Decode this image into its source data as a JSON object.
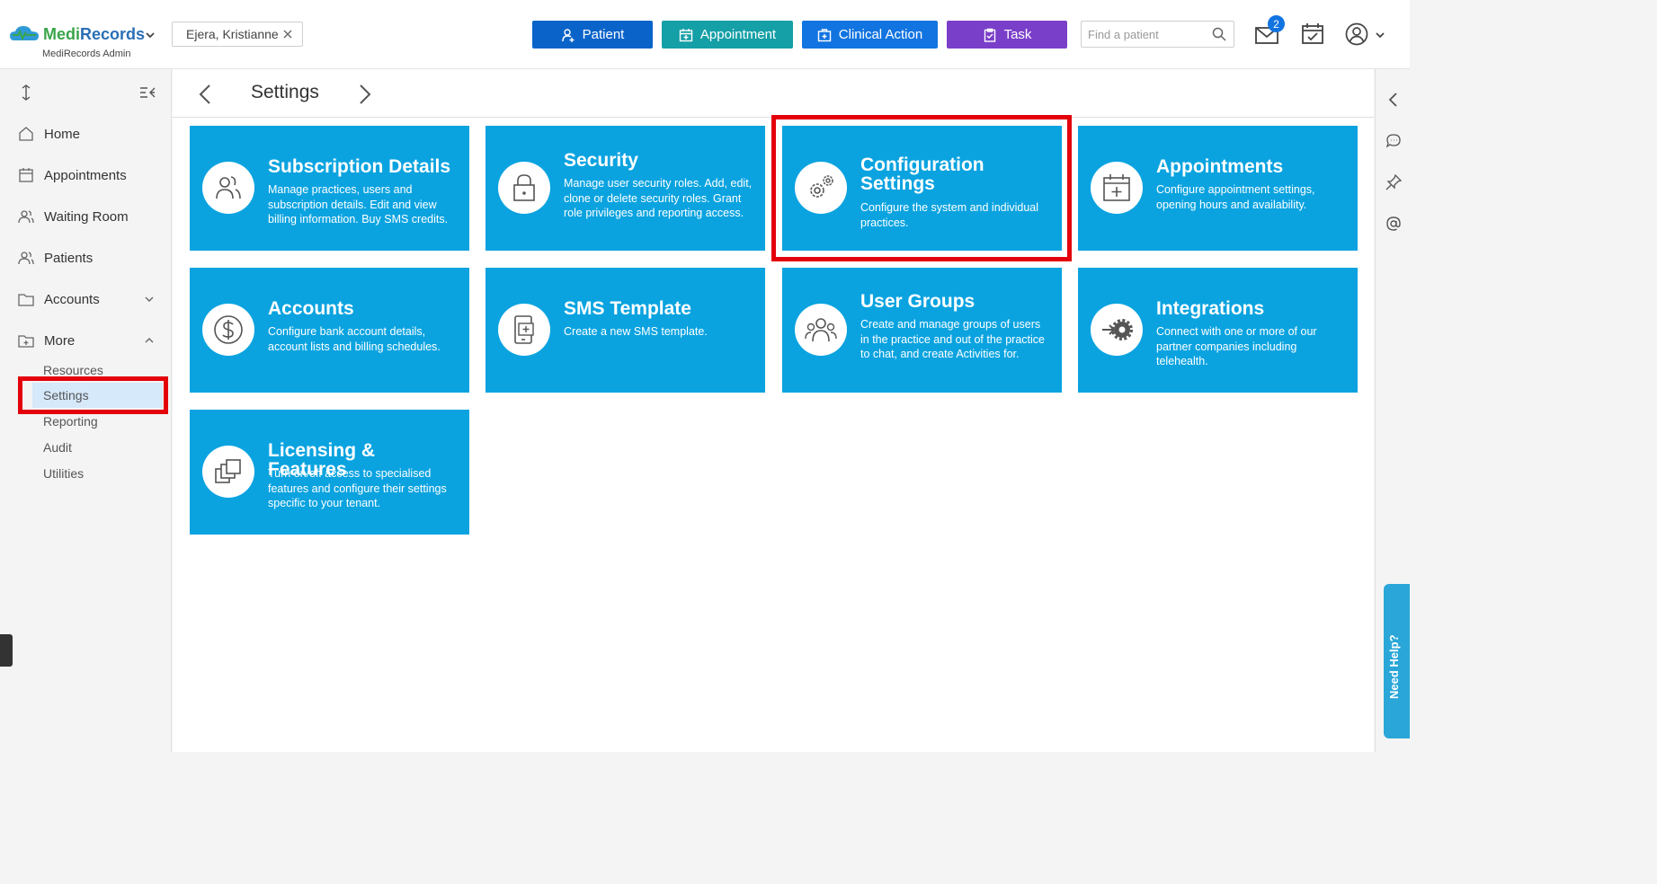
{
  "header": {
    "brand": "MediRecords",
    "brand_sub": "MediRecords Admin",
    "current_patient": "Ejera, Kristianne",
    "buttons": {
      "patient": "Patient",
      "appointment": "Appointment",
      "clinical_action": "Clinical Action",
      "task": "Task"
    },
    "search_placeholder": "Find a patient",
    "mail_badge": "2"
  },
  "sidebar": {
    "items": [
      {
        "label": "Home",
        "icon": "home-icon"
      },
      {
        "label": "Appointments",
        "icon": "calendar-icon"
      },
      {
        "label": "Waiting Room",
        "icon": "users-icon"
      },
      {
        "label": "Patients",
        "icon": "patients-icon"
      },
      {
        "label": "Accounts",
        "icon": "folder-icon"
      },
      {
        "label": "More",
        "icon": "folder-plus-icon"
      }
    ],
    "sub_items": [
      "Resources",
      "Settings",
      "Reporting",
      "Audit",
      "Utilities"
    ],
    "selected": "Settings"
  },
  "page": {
    "title": "Settings"
  },
  "tiles": [
    {
      "title": "Subscription Details",
      "desc": "Manage practices, users and subscription details. Edit and view billing information. Buy SMS credits.",
      "icon": "users-icon"
    },
    {
      "title": "Security",
      "desc": "Manage user security roles. Add, edit, clone or delete security roles. Grant role privileges and reporting access.",
      "icon": "lock-icon"
    },
    {
      "title": "Configuration Settings",
      "desc": "Configure the system and individual practices.",
      "icon": "gears-icon"
    },
    {
      "title": "Appointments",
      "desc": "Configure appointment settings, opening hours and availability.",
      "icon": "calendar-plus-icon"
    },
    {
      "title": "Accounts",
      "desc": "Configure bank account details, account lists and billing schedules.",
      "icon": "dollar-icon"
    },
    {
      "title": "SMS Template",
      "desc": "Create a new SMS template.",
      "icon": "phone-plus-icon"
    },
    {
      "title": "User Groups",
      "desc": "Create and manage groups of users in the practice and out of the practice to chat, and create Activities for.",
      "icon": "user-group-icon"
    },
    {
      "title": "Integrations",
      "desc": "Connect with one or more of our partner companies including telehealth.",
      "icon": "integration-gear-icon"
    },
    {
      "title": "Licensing & Features",
      "desc": "Turn on/off access to specialised features and configure their settings specific to your tenant.",
      "icon": "layers-icon"
    }
  ],
  "help": {
    "label": "Need Help?"
  },
  "colors": {
    "tile": "#0aa3e0",
    "highlight": "#e3000b",
    "patient_btn": "#0a63c9",
    "appointment_btn": "#159fa6",
    "clinical_btn": "#1274e0",
    "task_btn": "#7a3fc9"
  }
}
